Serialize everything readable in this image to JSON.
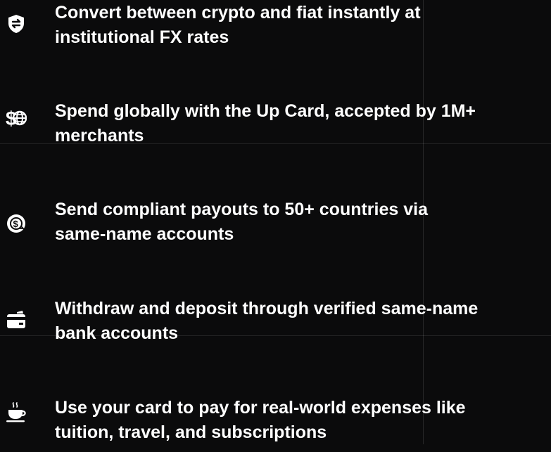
{
  "features": [
    {
      "icon": "shield-exchange-icon",
      "lines": [
        "Convert between crypto and fiat instantly at",
        "institutional FX rates"
      ]
    },
    {
      "icon": "dollar-globe-icon",
      "lines": [
        "Spend globally with the Up Card, accepted by 1M+",
        "merchants"
      ]
    },
    {
      "icon": "dollar-transfer-icon",
      "lines": [
        "Send compliant payouts to 50+ countries via",
        "same-name accounts"
      ]
    },
    {
      "icon": "bank-card-icon",
      "lines": [
        "Withdraw and deposit through verified same-name",
        "bank accounts"
      ]
    },
    {
      "icon": "coffee-cup-icon",
      "lines": [
        "Use your card to pay for real-world expenses like",
        "tuition, travel, and subscriptions"
      ]
    }
  ]
}
